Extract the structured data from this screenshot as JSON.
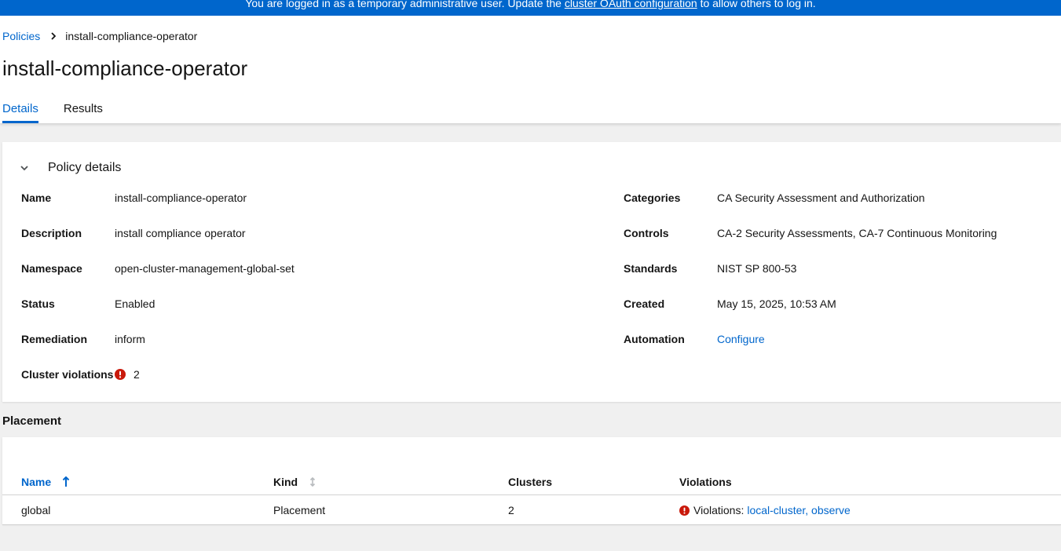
{
  "banner": {
    "text_before": "You are logged in as a temporary administrative user. Update the ",
    "link": "cluster OAuth configuration",
    "text_after": " to allow others to log in."
  },
  "breadcrumb": {
    "parent": "Policies",
    "current": "install-compliance-operator"
  },
  "page": {
    "title": "install-compliance-operator"
  },
  "tabs": [
    {
      "label": "Details",
      "active": true
    },
    {
      "label": "Results",
      "active": false
    }
  ],
  "details": {
    "section_title": "Policy details",
    "left": [
      {
        "term": "Name",
        "value": "install-compliance-operator"
      },
      {
        "term": "Description",
        "value": "install compliance operator"
      },
      {
        "term": "Namespace",
        "value": "open-cluster-management-global-set"
      },
      {
        "term": "Status",
        "value": "Enabled"
      },
      {
        "term": "Remediation",
        "value": "inform"
      },
      {
        "term": "Cluster violations",
        "value": "2",
        "icon": "exclamation-circle-icon"
      }
    ],
    "right": [
      {
        "term": "Categories",
        "value": "CA Security Assessment and Authorization"
      },
      {
        "term": "Controls",
        "value": "CA-2 Security Assessments, CA-7 Continuous Monitoring"
      },
      {
        "term": "Standards",
        "value": "NIST SP 800-53"
      },
      {
        "term": "Created",
        "value": "May 15, 2025, 10:53 AM"
      },
      {
        "term": "Automation",
        "value": "Configure",
        "is_link": true
      }
    ]
  },
  "placement": {
    "title": "Placement",
    "columns": {
      "name": "Name",
      "kind": "Kind",
      "clusters": "Clusters",
      "violations": "Violations"
    },
    "rows": [
      {
        "name": "global",
        "kind": "Placement",
        "clusters": "2",
        "violations_label": "Violations:",
        "violations_links": "local-cluster, observe"
      }
    ]
  },
  "colors": {
    "accent": "#0066cc",
    "danger": "#c9190b",
    "banner": "#0066cc"
  }
}
